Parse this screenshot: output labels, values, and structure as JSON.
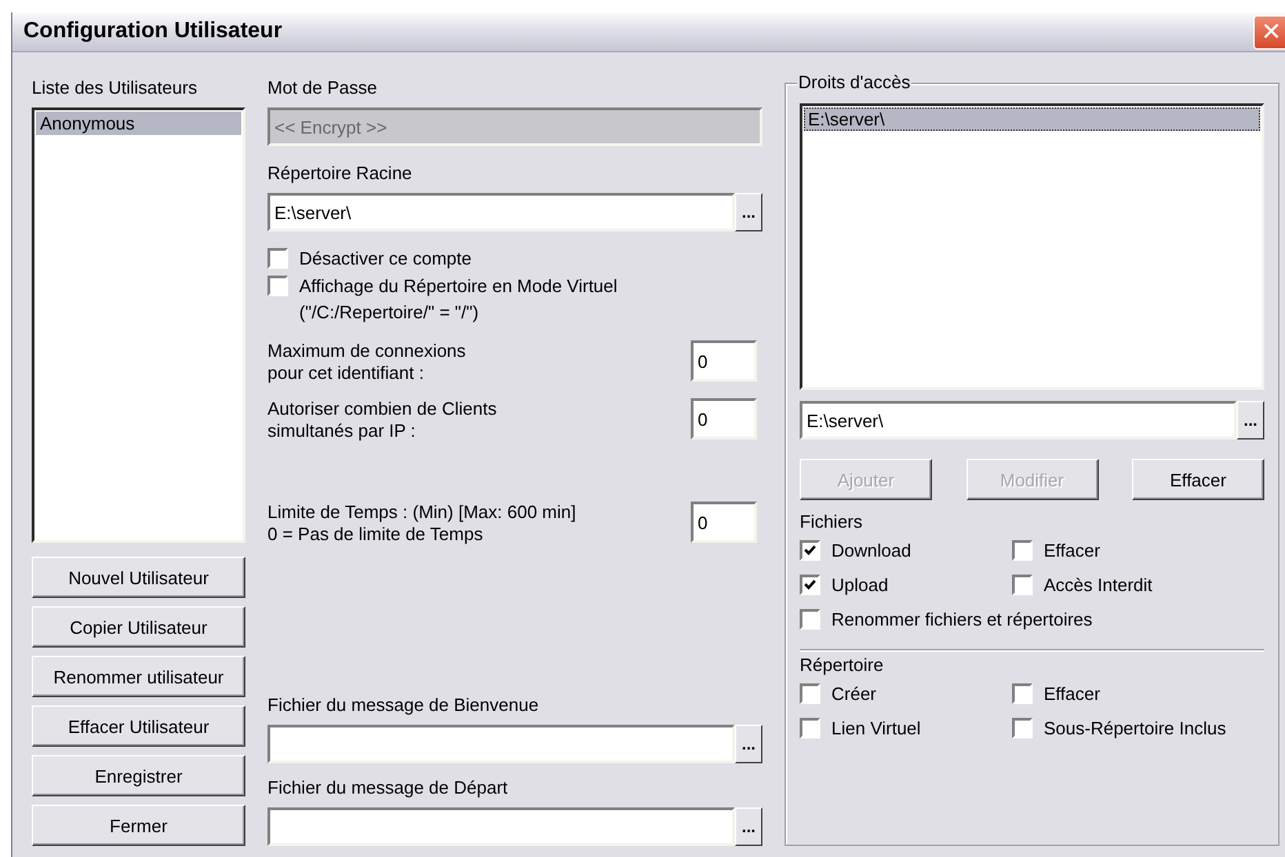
{
  "window": {
    "title": "Configuration Utilisateur",
    "close": "✕"
  },
  "users": {
    "label": "Liste des Utilisateurs",
    "items": [
      {
        "name": "Anonymous",
        "selected": true
      }
    ]
  },
  "user_buttons": [
    {
      "label": "Nouvel Utilisateur"
    },
    {
      "label": "Copier Utilisateur"
    },
    {
      "label": "Renommer utilisateur"
    },
    {
      "label": "Effacer Utilisateur"
    },
    {
      "label": "Enregistrer"
    },
    {
      "label": "Fermer"
    }
  ],
  "password": {
    "label": "Mot de Passe",
    "value": "<< Encrypt >>",
    "disabled": true
  },
  "root_dir": {
    "label": "Répertoire Racine",
    "value": "E:\\server\\",
    "browse": "..."
  },
  "options": [
    {
      "label": "Désactiver ce compte",
      "checked": false
    },
    {
      "label": "Affichage du Répertoire en Mode Virtuel",
      "checked": false,
      "note": "(\"/C:/Repertoire/\" = \"/\")"
    }
  ],
  "limits": [
    {
      "lines": [
        "Maximum de connexions",
        "pour cet identifiant :"
      ],
      "value": "0"
    },
    {
      "lines": [
        "Autoriser combien de Clients",
        "simultanés par IP :"
      ],
      "value": "0"
    },
    {
      "lines": [
        "Limite de Temps : (Min) [Max: 600 min]",
        "0 = Pas de limite de Temps"
      ],
      "value": "0"
    }
  ],
  "message_files": [
    {
      "label": "Fichier du message de Bienvenue",
      "browse": "..."
    },
    {
      "label": "Fichier du message de Départ",
      "browse": "..."
    }
  ],
  "access": {
    "title": "Droits d'accès",
    "items": [
      {
        "path": "E:\\server\\",
        "selected": true
      }
    ],
    "path_field": {
      "value": "E:\\server\\",
      "browse": "..."
    },
    "buttons": [
      {
        "label": "Ajouter",
        "disabled": true
      },
      {
        "label": "Modifier",
        "disabled": true
      },
      {
        "label": "Effacer",
        "disabled": false
      }
    ],
    "groups": [
      {
        "label": "Fichiers",
        "options": [
          {
            "label": "Download",
            "checked": true
          },
          {
            "label": "Effacer",
            "checked": false
          },
          {
            "label": "Upload",
            "checked": true
          },
          {
            "label": "Accès Interdit",
            "checked": false
          },
          {
            "label": "Renommer fichiers et répertoires",
            "checked": false
          }
        ]
      },
      {
        "label": "Répertoire",
        "options": [
          {
            "label": "Créer",
            "checked": false
          },
          {
            "label": "Effacer",
            "checked": false
          },
          {
            "label": "Lien Virtuel",
            "checked": false
          },
          {
            "label": "Sous-Répertoire Inclus",
            "checked": false
          }
        ]
      }
    ]
  }
}
